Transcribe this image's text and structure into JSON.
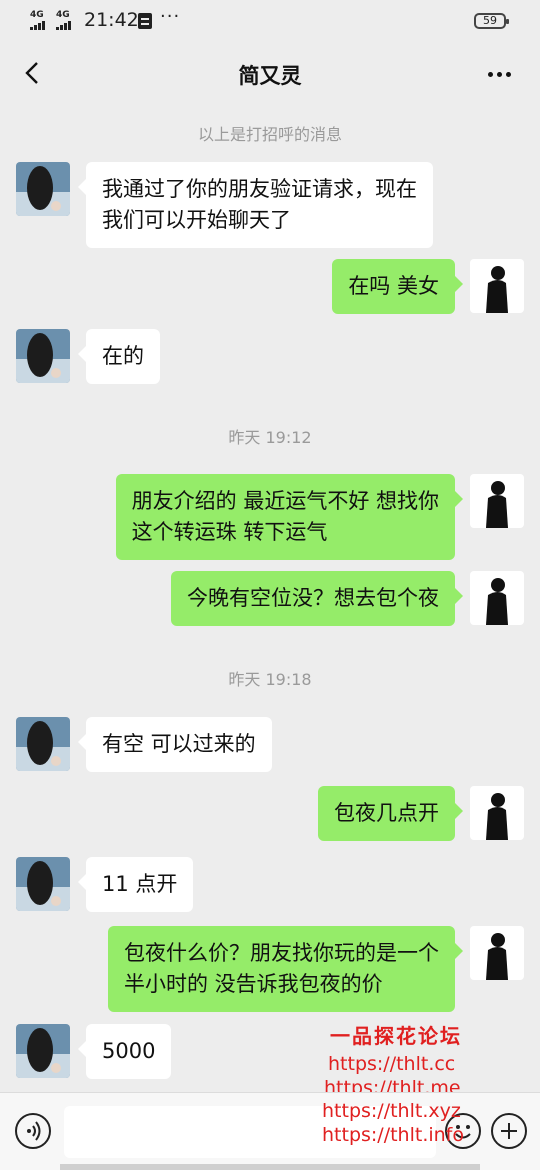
{
  "status_bar": {
    "signal_1": "4G",
    "signal_2": "4G",
    "time": "21:42",
    "more": "···",
    "battery": "59"
  },
  "header": {
    "title": "简又灵",
    "back_icon": "chevron-left-icon",
    "more_icon": "more-dots-icon"
  },
  "messages": {
    "greeting_notice": "以上是打招呼的消息",
    "m1": {
      "from": "contact",
      "line1": "我通过了你的朋友验证请求，现在",
      "line2": "我们可以开始聊天了"
    },
    "m2": {
      "from": "me",
      "text": "在吗 美女"
    },
    "m3": {
      "from": "contact",
      "text": "在的"
    },
    "ts1": "昨天 19:12",
    "m4": {
      "from": "me",
      "line1": "朋友介绍的  最近运气不好 想找你",
      "line2": "这个转运珠 转下运气"
    },
    "m5": {
      "from": "me",
      "text": "今晚有空位没？想去包个夜"
    },
    "ts2": "昨天 19:18",
    "m6": {
      "from": "contact",
      "text": "有空 可以过来的"
    },
    "m7": {
      "from": "me",
      "text": "包夜几点开"
    },
    "m8": {
      "from": "contact",
      "text": "11 点开"
    },
    "m9": {
      "from": "me",
      "line1": "包夜什么价？朋友找你玩的是一个",
      "line2": "半小时的 没告诉我包夜的价"
    },
    "m10": {
      "from": "contact",
      "text": "5000"
    }
  },
  "watermark": {
    "title": "一品探花论坛",
    "links": [
      "https://thlt.cc",
      "https://thlt.me",
      "https://thlt.xyz",
      "https://thlt.info"
    ]
  },
  "input_bar": {
    "voice_icon": "voice-icon",
    "input_value": "",
    "emoji_icon": "emoji-icon",
    "plus_icon": "plus-icon"
  },
  "colors": {
    "background": "#ededed",
    "bubble_me": "#95ec69",
    "bubble_contact": "#ffffff",
    "system_text": "#9a9a9a",
    "watermark": "#e02020"
  }
}
